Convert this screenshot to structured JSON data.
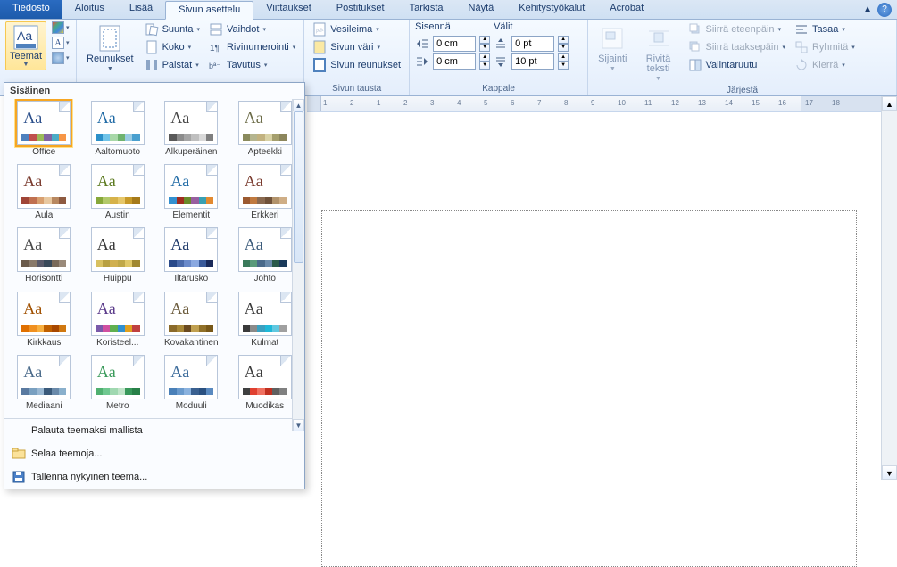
{
  "tabs": {
    "file": "Tiedosto",
    "list": [
      "Aloitus",
      "Lisää",
      "Sivun asettelu",
      "Viittaukset",
      "Postitukset",
      "Tarkista",
      "Näytä",
      "Kehitystyökalut",
      "Acrobat"
    ],
    "active_index": 2
  },
  "ribbon": {
    "themes": {
      "label": "Teemat"
    },
    "margins": {
      "label": "Reunukset"
    },
    "pagesetup": {
      "orientation": "Suunta",
      "size": "Koko",
      "columns": "Palstat",
      "breaks": "Vaihdot",
      "linenumbers": "Rivinumerointi",
      "hyphenation": "Tavutus"
    },
    "pagebg": {
      "watermark": "Vesileima",
      "pagecolor": "Sivun väri",
      "borders": "Sivun reunukset",
      "group_label": "Sivun tausta"
    },
    "paragraph": {
      "indent_label": "Sisennä",
      "spacing_label": "Välit",
      "indent_left": "0 cm",
      "indent_right": "0 cm",
      "space_before": "0 pt",
      "space_after": "10 pt",
      "group_label": "Kappale"
    },
    "arrange": {
      "position": "Sijainti",
      "wrap": "Rivitä teksti",
      "bringforward": "Siirrä eteenpäin",
      "sendback": "Siirrä taaksepäin",
      "selectionpane": "Valintaruutu",
      "align": "Tasaa",
      "group": "Ryhmitä",
      "rotate": "Kierrä",
      "group_label": "Järjestä"
    }
  },
  "gallery": {
    "header": "Sisäinen",
    "themes": [
      {
        "name": "Office",
        "aa_color": "#2a4e8a",
        "bars": [
          "#4f81bd",
          "#c0504d",
          "#9bbb59",
          "#8064a2",
          "#4bacc6",
          "#f79646"
        ],
        "selected": true
      },
      {
        "name": "Aaltomuoto",
        "aa_color": "#1f6aa5",
        "bars": [
          "#2c90c9",
          "#71c4e8",
          "#a8d8a8",
          "#6fb36f",
          "#9acbe3",
          "#4aa0cf"
        ]
      },
      {
        "name": "Alkuperäinen",
        "aa_color": "#444444",
        "bars": [
          "#595959",
          "#8c8c8c",
          "#a5a5a5",
          "#bfbfbf",
          "#d9d9d9",
          "#7f7f7f"
        ]
      },
      {
        "name": "Apteekki",
        "aa_color": "#6b6b47",
        "bars": [
          "#8a8a5c",
          "#b5b58f",
          "#c2b280",
          "#d9d2a5",
          "#a59f6d",
          "#8c865c"
        ]
      },
      {
        "name": "Aula",
        "aa_color": "#7a3b2e",
        "bars": [
          "#a04537",
          "#c07050",
          "#d8a070",
          "#e8c8a0",
          "#b88860",
          "#8e5a40"
        ]
      },
      {
        "name": "Austin",
        "aa_color": "#5c7a1f",
        "bars": [
          "#87a83a",
          "#b2c96a",
          "#d6b24a",
          "#e6c76a",
          "#c79a2a",
          "#a67a1a"
        ]
      },
      {
        "name": "Elementit",
        "aa_color": "#1f6aa5",
        "bars": [
          "#3390d0",
          "#a02c20",
          "#6a8a2a",
          "#985fa0",
          "#39a0b2",
          "#e38a30"
        ]
      },
      {
        "name": "Erkkeri",
        "aa_color": "#7a3b2e",
        "bars": [
          "#9c5a30",
          "#c07a40",
          "#8a6a50",
          "#70523a",
          "#b2936c",
          "#cfae86"
        ]
      },
      {
        "name": "Horisontti",
        "aa_color": "#4a4a4a",
        "bars": [
          "#6b5b4b",
          "#8a7a6a",
          "#5a5a6a",
          "#3a4a5a",
          "#7a6a5a",
          "#9a8a7a"
        ]
      },
      {
        "name": "Huippu",
        "aa_color": "#3a3a3a",
        "bars": [
          "#d8c060",
          "#b8a040",
          "#d0b050",
          "#c0a848",
          "#e0c868",
          "#a08830"
        ]
      },
      {
        "name": "Iltarusko",
        "aa_color": "#1f3a6a",
        "bars": [
          "#2a4a8a",
          "#4a6aaa",
          "#6a8aca",
          "#8aa8e0",
          "#3a5a9a",
          "#1a2a5a"
        ]
      },
      {
        "name": "Johto",
        "aa_color": "#3a5a7a",
        "bars": [
          "#3a7a5a",
          "#5a9a7a",
          "#4a6a8a",
          "#6a8aaa",
          "#2a5a4a",
          "#1a3a5a"
        ]
      },
      {
        "name": "Kirkkaus",
        "aa_color": "#a05000",
        "bars": [
          "#e07000",
          "#f09020",
          "#f8b040",
          "#c06000",
          "#a84800",
          "#d07810"
        ]
      },
      {
        "name": "Koristeel...",
        "aa_color": "#5a3a8a",
        "bars": [
          "#7a5aaa",
          "#d050a0",
          "#60b050",
          "#3090d0",
          "#e0a020",
          "#c04040"
        ]
      },
      {
        "name": "Kovakantinen",
        "aa_color": "#6a5a3a",
        "bars": [
          "#8a6a2a",
          "#a88838",
          "#6a4a20",
          "#c0a050",
          "#907028",
          "#785818"
        ]
      },
      {
        "name": "Kulmat",
        "aa_color": "#3a3a3a",
        "bars": [
          "#3a3a3a",
          "#8a8a8a",
          "#3aa0c0",
          "#20b8d8",
          "#60c8e0",
          "#a0a0a0"
        ]
      },
      {
        "name": "Mediaani",
        "aa_color": "#4a6a8a",
        "bars": [
          "#5a7aa0",
          "#7aa0c0",
          "#9ab8d2",
          "#3a5a7a",
          "#6a8aaa",
          "#8ab0cc"
        ]
      },
      {
        "name": "Metro",
        "aa_color": "#3a9a5a",
        "bars": [
          "#50b070",
          "#70c890",
          "#a0d8b0",
          "#c0e4c8",
          "#38985a",
          "#288048"
        ]
      },
      {
        "name": "Moduuli",
        "aa_color": "#3a6a9a",
        "bars": [
          "#4a80b8",
          "#6a9acc",
          "#8ab2de",
          "#3a6090",
          "#2a5080",
          "#5a8ac0"
        ]
      },
      {
        "name": "Muodikas",
        "aa_color": "#3a3a3a",
        "bars": [
          "#404040",
          "#e04030",
          "#f07060",
          "#c03020",
          "#606060",
          "#808080"
        ]
      }
    ],
    "footer": {
      "reset": "Palauta teemaksi mallista",
      "browse": "Selaa teemoja...",
      "save": "Tallenna nykyinen teema..."
    }
  },
  "ruler": {
    "numbers": [
      1,
      2,
      1,
      2,
      3,
      4,
      5,
      6,
      7,
      8,
      9,
      10,
      11,
      12,
      13,
      14,
      15,
      16,
      17,
      18
    ]
  }
}
